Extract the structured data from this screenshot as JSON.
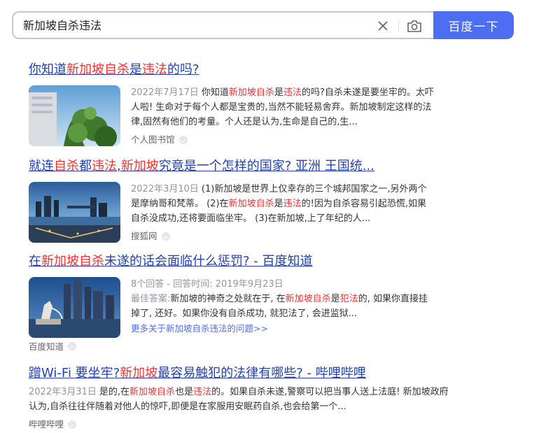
{
  "search": {
    "query": "新加坡自杀违法",
    "button_label": "百度一下"
  },
  "results": [
    {
      "title_parts": [
        "你知道",
        "新加坡自杀",
        "是",
        "违法",
        "的吗?"
      ],
      "date": "2022年7月17日",
      "snippet_parts": [
        "你知道",
        "新加坡自杀",
        "是",
        "违法",
        "的吗?自杀未遂是要坐牢的。太吓人啦! 生命对于每个人都是宝贵的,当然不能轻易舍弃。新加坡制定这样的法律,固然有他们的考量。个人还是认为,生命是自己的,生..."
      ],
      "source": "个人图书馆"
    },
    {
      "title_parts": [
        "就连",
        "自杀",
        "都",
        "违法",
        ",",
        "新加坡",
        "究竟是一个怎样的国家? 亚洲 王国统..."
      ],
      "date": "2022年3月10日",
      "snippet_parts": [
        "(1)新加坡是世界上仅幸存的三个城邦国家之一,另外两个是摩纳哥和梵蒂。 (2)在",
        "新加坡自杀",
        "是",
        "违法",
        "的!因为自杀容易引起恐慌,如果自杀没成功,还将要面临坐牢。 (3)在新加坡,上了年纪的人..."
      ],
      "source": "搜狐网"
    },
    {
      "title_parts": [
        "在",
        "新加坡自杀",
        "未遂的话会面临什么惩罚? - 百度知道"
      ],
      "meta": "8个回答 - 回答时间: 2019年9月23日",
      "best_label": "最佳答案:",
      "snippet_parts": [
        "新加坡的神奇之处就在于, 在",
        "新加坡自杀",
        "是",
        "犯法",
        "的, 如果你直接挂掉了, 还好。如果你没有自杀成功, 就犯法了, 会进监狱..."
      ],
      "more_link": "更多关于新加坡自杀违法的问题>>",
      "source": "百度知道"
    },
    {
      "title_parts": [
        "蹭Wi-Fi 要坐牢?",
        "新加坡",
        "最容易触犯的法律有哪些? - 哔哩哔哩"
      ],
      "date": "2022年3月31日",
      "snippet_parts": [
        "是的,在",
        "新加坡自杀",
        "也是",
        "违法",
        "的。如果自杀未遂,警察可以把当事人送上法庭! 新加坡政府认为,自杀往往伴随着对他人的惊吓,即便是在家服用安眠药自杀,也会给第一个..."
      ],
      "source": "哔哩哔哩"
    }
  ],
  "colors": {
    "accent": "#4e6ef2",
    "title_link": "#2440b3",
    "highlight": "#f73131",
    "meta_grey": "#9195a3"
  }
}
